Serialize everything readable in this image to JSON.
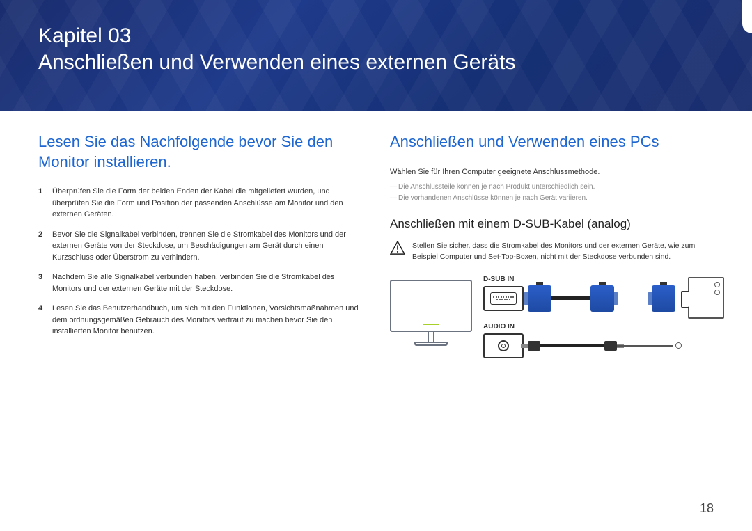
{
  "banner": {
    "chapter": "Kapitel 03",
    "title": "Anschließen und Verwenden eines externen Geräts"
  },
  "left": {
    "heading": "Lesen Sie das Nachfolgende bevor Sie den Monitor installieren.",
    "steps": [
      "Überprüfen Sie die Form der beiden Enden der Kabel die mitgeliefert wurden, und überprüfen Sie die Form und Position der passenden Anschlüsse am Monitor und den externen Geräten.",
      "Bevor Sie die Signalkabel verbinden, trennen Sie die Stromkabel des Monitors und der externen Geräte von der Steckdose, um Beschädigungen am Gerät durch einen Kurzschluss oder Überstrom zu verhindern.",
      "Nachdem Sie alle Signalkabel verbunden haben, verbinden Sie die Stromkabel des Monitors und der externen Geräte mit der Steckdose.",
      "Lesen Sie das Benutzerhandbuch, um sich mit den Funktionen, Vorsichtsmaßnahmen und dem ordnungsgemäßen Gebrauch des Monitors vertraut zu machen bevor Sie den installierten Monitor benutzen."
    ]
  },
  "right": {
    "heading": "Anschließen und Verwenden eines PCs",
    "intro": "Wählen Sie für Ihren Computer geeignete Anschlussmethode.",
    "notes": [
      "Die Anschlussteile können je nach Produkt unterschiedlich sein.",
      "Die vorhandenen Anschlüsse können je nach Gerät variieren."
    ],
    "subheading": "Anschließen mit einem D-SUB-Kabel (analog)",
    "warning": "Stellen Sie sicher, dass die Stromkabel des Monitors und der externen Geräte, wie zum Beispiel Computer und Set-Top-Boxen, nicht mit der Steckdose verbunden sind.",
    "labels": {
      "dsub": "D-SUB IN",
      "audio": "AUDIO IN"
    }
  },
  "page": "18"
}
